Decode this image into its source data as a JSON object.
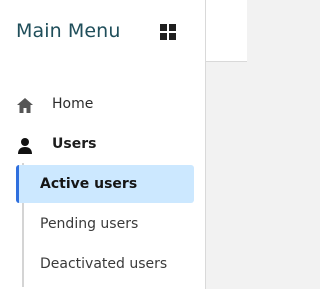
{
  "sidebar": {
    "title": "Main Menu",
    "menu_icon": "grid-icon",
    "items": [
      {
        "label": "Home",
        "icon": "home-icon"
      },
      {
        "label": "Users",
        "icon": "user-icon"
      }
    ],
    "subitems": [
      {
        "label": "Active users",
        "active": true
      },
      {
        "label": "Pending users",
        "active": false
      },
      {
        "label": "Deactivated users",
        "active": false
      }
    ]
  },
  "colors": {
    "title": "#1f4e5a",
    "active_bg": "#cce8ff",
    "active_border": "#2f6fde"
  }
}
